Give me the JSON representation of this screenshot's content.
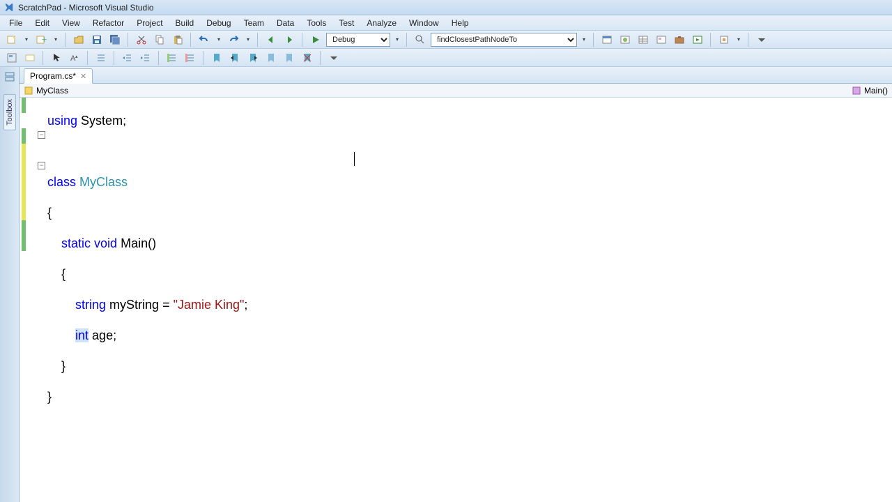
{
  "title": "ScratchPad - Microsoft Visual Studio",
  "menu": [
    "File",
    "Edit",
    "View",
    "Refactor",
    "Project",
    "Build",
    "Debug",
    "Team",
    "Data",
    "Tools",
    "Test",
    "Analyze",
    "Window",
    "Help"
  ],
  "toolbar": {
    "debug_config": "Debug",
    "find_text": "findClosestPathNodeTo"
  },
  "left_rail": {
    "toolbox": "Toolbox"
  },
  "tab": {
    "label": "Program.cs*"
  },
  "nav": {
    "class": "MyClass",
    "method": "Main()"
  },
  "code": {
    "l1": {
      "kw_using": "using",
      "sys": "System",
      "semi": ";"
    },
    "l3": {
      "kw_class": "class",
      "name": "MyClass"
    },
    "l4": "{",
    "l5": {
      "kw_static": "static",
      "kw_void": "void",
      "name": "Main",
      "parens": "()"
    },
    "l6": "    {",
    "l7": {
      "kw_string": "string",
      "ident": "myString",
      "eq": " = ",
      "str": "\"Jamie King\"",
      "semi": ";"
    },
    "l8": {
      "kw_int": "int",
      "ident": "age",
      "semi": ";"
    },
    "l9": "    }",
    "l10": "}"
  }
}
